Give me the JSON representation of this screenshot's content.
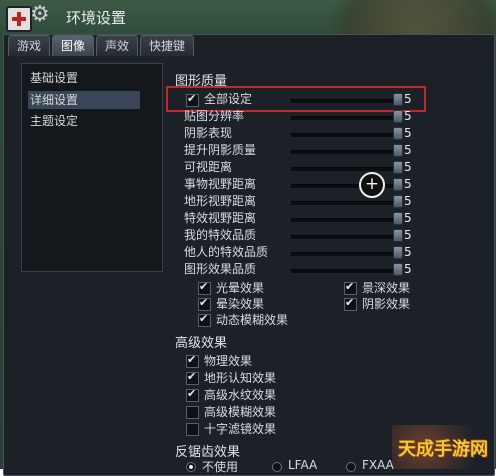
{
  "window": {
    "title": "环境设置"
  },
  "tabs": [
    {
      "label": "游戏"
    },
    {
      "label": "图像",
      "active": true
    },
    {
      "label": "声效"
    },
    {
      "label": "快捷键"
    }
  ],
  "sidebar": {
    "items": [
      {
        "label": "基础设置"
      },
      {
        "label": "详细设置",
        "selected": true
      },
      {
        "label": "主题设定"
      }
    ]
  },
  "graphics": {
    "section_title": "图形质量",
    "rows": [
      {
        "label": "全部设定",
        "value": "5",
        "checked": true
      },
      {
        "label": "贴图分辨率",
        "value": "5"
      },
      {
        "label": "阴影表现",
        "value": "5"
      },
      {
        "label": "提升阴影质量",
        "value": "5"
      },
      {
        "label": "可视距离",
        "value": "5"
      },
      {
        "label": "事物视野距离",
        "value": "5"
      },
      {
        "label": "地形视野距离",
        "value": "5"
      },
      {
        "label": "特效视野距离",
        "value": "5"
      },
      {
        "label": "我的特效品质",
        "value": "5"
      },
      {
        "label": "他人的特效品质",
        "value": "5"
      },
      {
        "label": "图形效果品质",
        "value": "5"
      }
    ],
    "effects": [
      {
        "label": "光晕效果",
        "checked": true
      },
      {
        "label": "景深效果",
        "checked": true
      },
      {
        "label": "晕染效果",
        "checked": true
      },
      {
        "label": "阴影效果",
        "checked": true
      },
      {
        "label": "动态模糊效果",
        "checked": true
      }
    ]
  },
  "advanced": {
    "section_title": "高级效果",
    "items": [
      {
        "label": "物理效果",
        "checked": true
      },
      {
        "label": "地形认知效果",
        "checked": true
      },
      {
        "label": "高级水纹效果",
        "checked": true
      },
      {
        "label": "高级模糊效果",
        "checked": false
      },
      {
        "label": "十字滤镜效果",
        "checked": false
      }
    ]
  },
  "antialias": {
    "section_title": "反锯齿效果",
    "options": [
      {
        "label": "不使用",
        "selected": true
      },
      {
        "label": "LFAA"
      },
      {
        "label": "FXAA"
      }
    ]
  },
  "watermark": {
    "text": "天成手游网"
  },
  "icons": {
    "app": "app-cross-icon",
    "settings": "gear-icon",
    "cursor": "plus-cursor-icon"
  }
}
